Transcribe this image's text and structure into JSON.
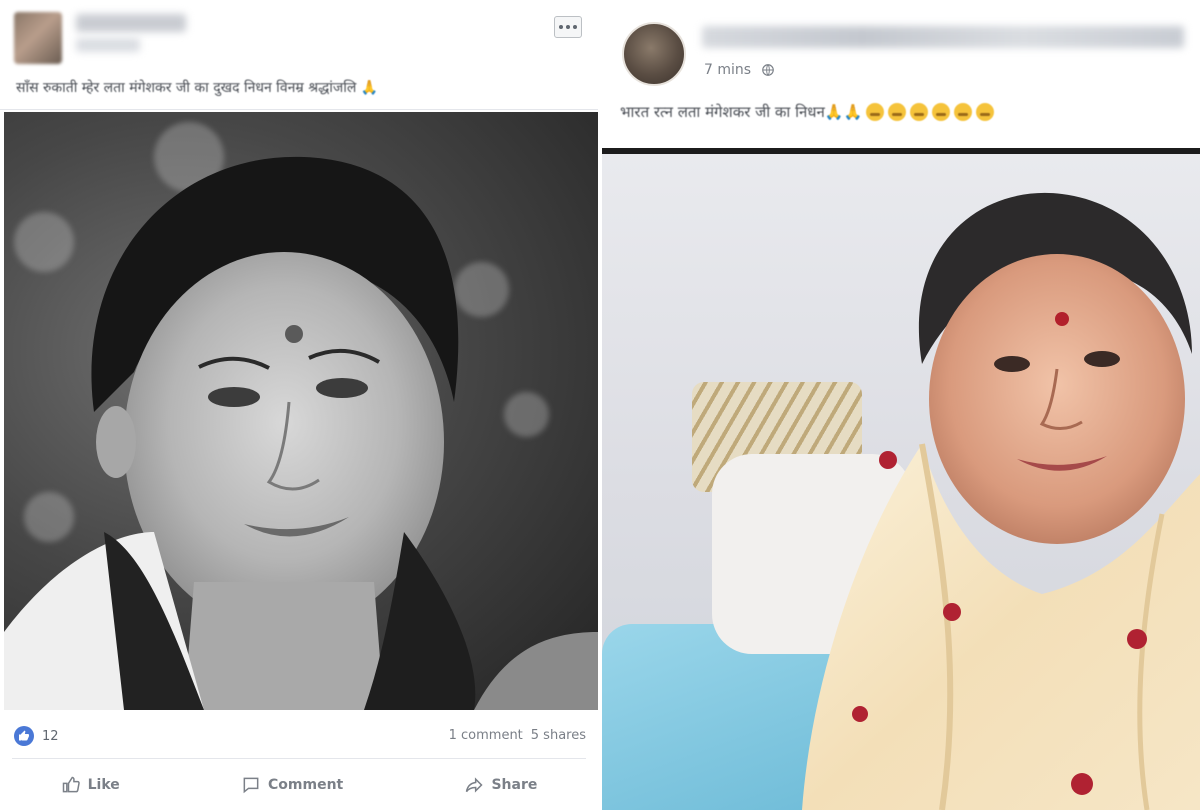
{
  "left_post": {
    "text": "साँस रुकाती म्हेर लता मंगेशकर जी का दुखद निधन विनम्र श्रद्धांजलि 🙏",
    "reaction_count": "12",
    "comments": "1 comment",
    "shares": "5 shares",
    "actions": {
      "like": "Like",
      "comment": "Comment",
      "share": "Share"
    }
  },
  "right_post": {
    "time": "7 mins",
    "text": "भारत रत्न लता मंगेशकर जी का निधन🙏🙏"
  },
  "colors": {
    "like_blue": "#4a78d6",
    "emoji_yellow": "#f5c33b",
    "text_gray": "#7b8088"
  }
}
